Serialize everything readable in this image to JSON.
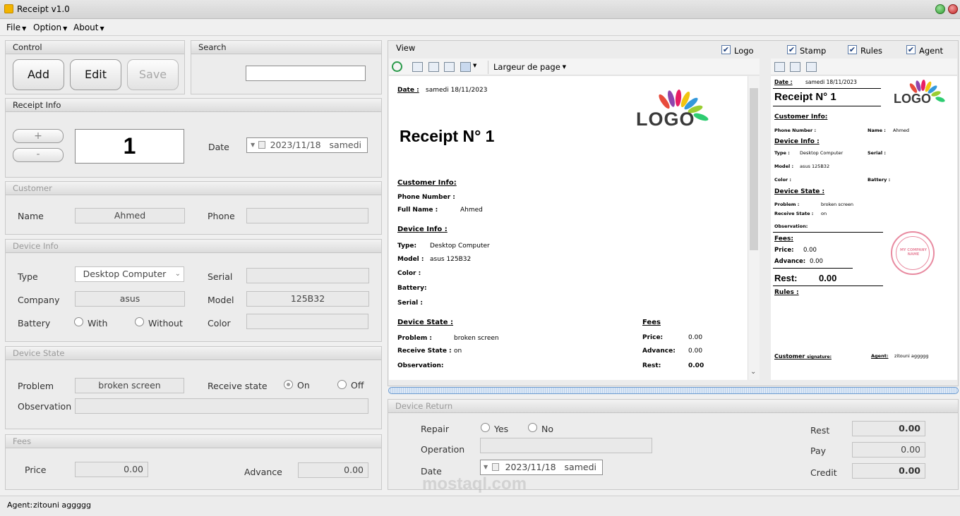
{
  "window": {
    "title": "Receipt v1.0"
  },
  "menu": {
    "file": "File",
    "option": "Option",
    "about": "About"
  },
  "control": {
    "title": "Control",
    "add": "Add",
    "edit": "Edit",
    "save": "Save"
  },
  "search": {
    "title": "Search",
    "value": ""
  },
  "receipt_info": {
    "title": "Receipt Info",
    "plus": "+",
    "minus": "-",
    "number": "1",
    "date_label": "Date",
    "date_value": "2023/11/18",
    "date_day": "samedi"
  },
  "customer": {
    "title": "Customer",
    "name_label": "Name",
    "name_value": "Ahmed",
    "phone_label": "Phone",
    "phone_value": ""
  },
  "device_info": {
    "title": "Device Info",
    "type_label": "Type",
    "type_value": "Desktop Computer",
    "serial_label": "Serial",
    "serial_value": "",
    "company_label": "Company",
    "company_value": "asus",
    "model_label": "Model",
    "model_value": "125B32",
    "battery_label": "Battery",
    "battery_with": "With",
    "battery_without": "Without",
    "color_label": "Color",
    "color_value": ""
  },
  "device_state": {
    "title": "Device State",
    "problem_label": "Problem",
    "problem_value": "broken screen",
    "receive_label": "Receive state",
    "on": "On",
    "off": "Off",
    "observation_label": "Observation",
    "observation_value": ""
  },
  "fees": {
    "title": "Fees",
    "price_label": "Price",
    "price_value": "0.00",
    "advance_label": "Advance",
    "advance_value": "0.00"
  },
  "agent_bar": {
    "label": "Agent:",
    "value": "zitouni aggggg"
  },
  "view": {
    "title": "View",
    "zoom": "Largeur de page",
    "options": {
      "logo": "Logo",
      "stamp": "Stamp",
      "rules": "Rules",
      "agent": "Agent"
    }
  },
  "doc": {
    "date_label": "Date :",
    "date_value": "samedi 18/11/2023",
    "receipt_title": "Receipt N°  1",
    "logo_text": "LOGO",
    "customer_info": "Customer Info:",
    "phone_label": "Phone Number :",
    "fullname_label": "Full Name :",
    "fullname_value": "Ahmed",
    "device_info": "Device Info :",
    "type_label": "Type:",
    "type_value": "Desktop Computer",
    "model_label": "Model :",
    "model_value": "asus  125B32",
    "color_label": "Color :",
    "battery_label": "Battery:",
    "serial_label": "Serial :",
    "device_state": "Device State :",
    "problem_label": "Problem  :",
    "problem_value": "broken screen",
    "receive_label": "Receive State :",
    "receive_value": "on",
    "observation_label": "Observation:",
    "fees": "Fees",
    "price_label": "Price:",
    "price_value": "0.00",
    "advance_label": "Advance:",
    "advance_value": "0.00",
    "rest_label": "Rest:",
    "rest_value": "0.00"
  },
  "small_doc": {
    "date_label": "Date :",
    "date_value": "samedi 18/11/2023",
    "receipt_title": "Receipt N°  1",
    "logo_text": "LOGO",
    "customer_info": "Customer Info:",
    "phone_label": "Phone Number :",
    "name_label": "Name :",
    "name_value": "Ahmed",
    "device_info": "Device Info :",
    "type_label": "Type :",
    "type_value": "Desktop Computer",
    "serial_label": "Serial :",
    "model_label": "Model :",
    "model_value": "asus  125B32",
    "color_label": "Color :",
    "battery_label": "Battery :",
    "device_state": "Device State :",
    "problem_label": "Problem   :",
    "problem_value": "broken screen",
    "receive_label": "Receive State :",
    "receive_value": "on",
    "observation_label": "Observation:",
    "fees": "Fees:",
    "price_label": "Price:",
    "price_value": "0.00",
    "advance_label": "Advance:",
    "advance_value": "0.00",
    "rest_label": "Rest:",
    "rest_value": "0.00",
    "rules": "Rules :",
    "customer_sig": "Customer",
    "customer_sig2": "signature:",
    "agent_label": "Agent:",
    "agent_value": "zitouni aggggg",
    "stamp_text": "MY COMPANY NAME"
  },
  "device_return": {
    "title": "Device Return",
    "repair_label": "Repair",
    "yes": "Yes",
    "no": "No",
    "operation_label": "Operation",
    "operation_value": "",
    "date_label": "Date",
    "date_value": "2023/11/18",
    "date_day": "samedi",
    "rest_label": "Rest",
    "rest_value": "0.00",
    "pay_label": "Pay",
    "pay_value": "0.00",
    "credit_label": "Credit",
    "credit_value": "0.00"
  },
  "watermark": {
    "text": "mostaql.com"
  }
}
